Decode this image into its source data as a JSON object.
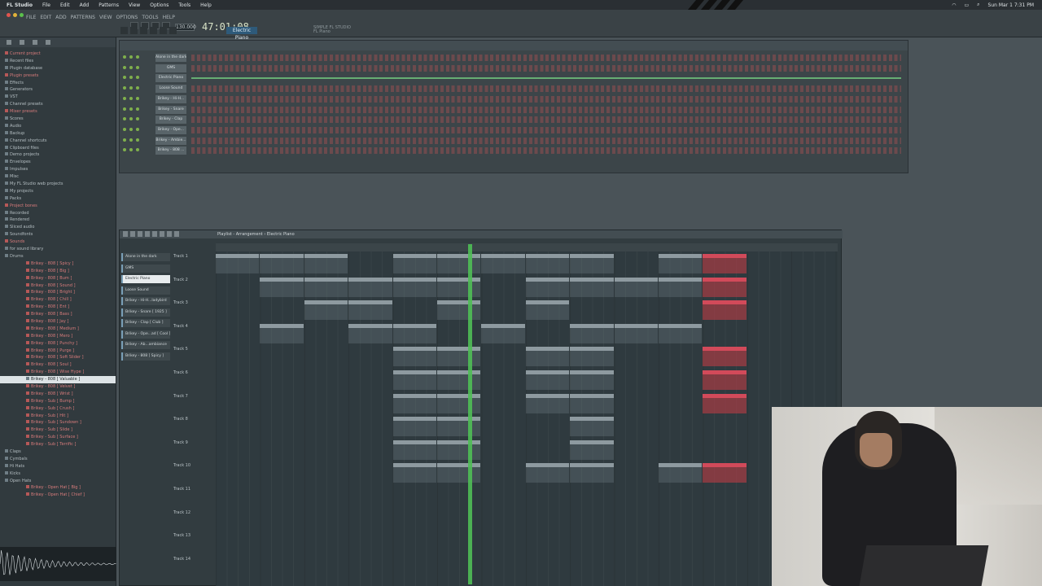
{
  "menubar": {
    "app": "FL Studio",
    "items": [
      "File",
      "Edit",
      "Add",
      "Patterns",
      "View",
      "Options",
      "Tools",
      "Help"
    ],
    "clock": "Sun Mar 1  7:31 PM"
  },
  "fl": {
    "menu": [
      "FILE",
      "EDIT",
      "ADD",
      "PATTERNS",
      "VIEW",
      "OPTIONS",
      "TOOLS",
      "HELP"
    ],
    "tempo": "130.000",
    "time": "47:01:08",
    "pattern": "Electric Piano",
    "hint": "SIMPLE FL STUDIO\nFL Piano"
  },
  "browser": {
    "items": [
      {
        "label": "Current project",
        "style": "red"
      },
      {
        "label": "Recent files",
        "style": "normal"
      },
      {
        "label": "Plugin database",
        "style": "normal"
      },
      {
        "label": "Plugin presets",
        "style": "red"
      },
      {
        "label": "Effects",
        "style": "normal"
      },
      {
        "label": "Generators",
        "style": "normal"
      },
      {
        "label": "VST",
        "style": "normal"
      },
      {
        "label": "Channel presets",
        "style": "normal"
      },
      {
        "label": "Mixer presets",
        "style": "red"
      },
      {
        "label": "Scores",
        "style": "normal"
      },
      {
        "label": "Audio",
        "style": "normal"
      },
      {
        "label": "Backup",
        "style": "normal"
      },
      {
        "label": "Channel shortcuts",
        "style": "normal"
      },
      {
        "label": "Clipboard files",
        "style": "normal"
      },
      {
        "label": "Demo projects",
        "style": "normal"
      },
      {
        "label": "Envelopes",
        "style": "normal"
      },
      {
        "label": "Impulses",
        "style": "normal"
      },
      {
        "label": "Misc",
        "style": "normal"
      },
      {
        "label": "My FL Studio web projects",
        "style": "normal"
      },
      {
        "label": "My projects",
        "style": "normal"
      },
      {
        "label": "Packs",
        "style": "normal"
      },
      {
        "label": "Project bones",
        "style": "red"
      },
      {
        "label": "Recorded",
        "style": "normal"
      },
      {
        "label": "Rendered",
        "style": "normal"
      },
      {
        "label": "Sliced audio",
        "style": "normal"
      },
      {
        "label": "Soundfonts",
        "style": "normal"
      },
      {
        "label": "Sounds",
        "style": "red"
      },
      {
        "label": "for sound library",
        "style": "normal"
      },
      {
        "label": "Drums",
        "style": "normal"
      },
      {
        "label": "Brikey - 808 [ Spicy ]",
        "style": "red"
      },
      {
        "label": "Brikey - 808 [ Big ]",
        "style": "red"
      },
      {
        "label": "Brikey - 808 [ Bum ]",
        "style": "red"
      },
      {
        "label": "Brikey - 808 [ Sound ]",
        "style": "red"
      },
      {
        "label": "Brikey - 808 [ Bright ]",
        "style": "red"
      },
      {
        "label": "Brikey - 808 [ Chill ]",
        "style": "red"
      },
      {
        "label": "Brikey - 808 [ Ent ]",
        "style": "red"
      },
      {
        "label": "Brikey - 808 [ Bass ]",
        "style": "red"
      },
      {
        "label": "Brikey - 808 [ Jay ]",
        "style": "red"
      },
      {
        "label": "Brikey - 808 [ Medium ]",
        "style": "red"
      },
      {
        "label": "Brikey - 808 [ Mero ]",
        "style": "red"
      },
      {
        "label": "Brikey - 808 [ Punchy ]",
        "style": "red"
      },
      {
        "label": "Brikey - 808 [ Purge ]",
        "style": "red"
      },
      {
        "label": "Brikey - 808 [ Soft Slider ]",
        "style": "red"
      },
      {
        "label": "Brikey - 808 [ Soul ]",
        "style": "red"
      },
      {
        "label": "Brikey - 808 [ Wise Hype ]",
        "style": "red"
      },
      {
        "label": "Brikey - 808 [ Valuable ]",
        "style": "sel"
      },
      {
        "label": "Brikey - 808 [ Velvet ]",
        "style": "red"
      },
      {
        "label": "Brikey - 808 [ Wrist ]",
        "style": "red"
      },
      {
        "label": "Brikey - Sub [ Bump ]",
        "style": "red"
      },
      {
        "label": "Brikey - Sub [ Crush ]",
        "style": "red"
      },
      {
        "label": "Brikey - Sub [ Hit ]",
        "style": "red"
      },
      {
        "label": "Brikey - Sub [ Sundown ]",
        "style": "red"
      },
      {
        "label": "Brikey - Sub [ Slide ]",
        "style": "red"
      },
      {
        "label": "Brikey - Sub [ Surface ]",
        "style": "red"
      },
      {
        "label": "Brikey - Sub [ Terrific ]",
        "style": "red"
      },
      {
        "label": "Claps",
        "style": "normal"
      },
      {
        "label": "Cymbals",
        "style": "normal"
      },
      {
        "label": "Hi Hats",
        "style": "normal"
      },
      {
        "label": "Kicks",
        "style": "normal"
      },
      {
        "label": "Open Hats",
        "style": "normal"
      },
      {
        "label": "Brikey - Open Hat [ Big ]",
        "style": "red"
      },
      {
        "label": "Brikey - Open Hat [ Chief ]",
        "style": "red"
      }
    ]
  },
  "rack": {
    "channels": [
      {
        "name": "Alone in the dark",
        "melodic": false
      },
      {
        "name": "GMS",
        "melodic": false
      },
      {
        "name": "Electric Piano",
        "melodic": true
      },
      {
        "name": "Loose Sound",
        "melodic": false
      },
      {
        "name": "Brikey - Hi-H...",
        "melodic": false
      },
      {
        "name": "Brikey - Snare",
        "melodic": false
      },
      {
        "name": "Brikey - Clap",
        "melodic": false
      },
      {
        "name": "Brikey - Ope...",
        "melodic": false
      },
      {
        "name": "Brikey - Ambie...",
        "melodic": false
      },
      {
        "name": "Brikey - 808 ...",
        "melodic": false
      }
    ]
  },
  "playlist": {
    "title": "Playlist - Arrangement › Electric Piano",
    "patterns": [
      {
        "name": "Alone in the dark",
        "sel": false
      },
      {
        "name": "GMS",
        "sel": false
      },
      {
        "name": "Electric Piano",
        "sel": true
      },
      {
        "name": "Loose Sound",
        "sel": false
      },
      {
        "name": "Brikey - Hi-H...ladybird",
        "sel": false
      },
      {
        "name": "Brikey - Snare [ 1925 ]",
        "sel": false
      },
      {
        "name": "Brikey - Clap [ Club ]",
        "sel": false
      },
      {
        "name": "Brikey - Ope...ad [ Cool ]",
        "sel": false
      },
      {
        "name": "Brikey - Ab...ambiance",
        "sel": false
      },
      {
        "name": "Brikey - 808 [ Spicy ]",
        "sel": false
      }
    ],
    "tracks": [
      "Track 1",
      "Track 2",
      "Track 3",
      "Track 4",
      "Track 5",
      "Track 6",
      "Track 7",
      "Track 8",
      "Track 9",
      "Track 10",
      "Track 11",
      "Track 12",
      "Track 13",
      "Track 14"
    ],
    "clips": [
      {
        "track": 1,
        "start": 1,
        "len": 4,
        "label": "Alone in the dark",
        "sel": false
      },
      {
        "track": 1,
        "start": 5,
        "len": 4,
        "label": "Alone in the dark",
        "sel": false
      },
      {
        "track": 1,
        "start": 9,
        "len": 4,
        "label": "Alone in the dark",
        "sel": false
      },
      {
        "track": 1,
        "start": 17,
        "len": 4,
        "label": "Alone in the dark",
        "sel": false
      },
      {
        "track": 1,
        "start": 21,
        "len": 4,
        "label": "Alone in the dark",
        "sel": false
      },
      {
        "track": 1,
        "start": 25,
        "len": 4,
        "label": "Alone in the dark",
        "sel": false
      },
      {
        "track": 1,
        "start": 29,
        "len": 4,
        "label": "Alone in the dark",
        "sel": false
      },
      {
        "track": 1,
        "start": 33,
        "len": 4,
        "label": "Alone in the dark",
        "sel": false
      },
      {
        "track": 1,
        "start": 41,
        "len": 4,
        "label": "Alone in the dark",
        "sel": false
      },
      {
        "track": 1,
        "start": 45,
        "len": 4,
        "label": "Alone in the dark",
        "sel": true
      },
      {
        "track": 2,
        "start": 5,
        "len": 4,
        "label": "GMS",
        "sel": false
      },
      {
        "track": 2,
        "start": 9,
        "len": 4,
        "label": "GMS",
        "sel": false
      },
      {
        "track": 2,
        "start": 13,
        "len": 4,
        "label": "GMS",
        "sel": false
      },
      {
        "track": 2,
        "start": 17,
        "len": 4,
        "label": "GMS",
        "sel": false
      },
      {
        "track": 2,
        "start": 21,
        "len": 4,
        "label": "GMS",
        "sel": false
      },
      {
        "track": 2,
        "start": 29,
        "len": 4,
        "label": "GMS",
        "sel": false
      },
      {
        "track": 2,
        "start": 33,
        "len": 4,
        "label": "GMS",
        "sel": false
      },
      {
        "track": 2,
        "start": 37,
        "len": 4,
        "label": "GMS",
        "sel": false
      },
      {
        "track": 2,
        "start": 41,
        "len": 4,
        "label": "GMS",
        "sel": false
      },
      {
        "track": 2,
        "start": 45,
        "len": 4,
        "label": "GMS",
        "sel": true
      },
      {
        "track": 3,
        "start": 9,
        "len": 4,
        "label": "Electric Piano",
        "sel": false
      },
      {
        "track": 3,
        "start": 13,
        "len": 4,
        "label": "Electric Piano",
        "sel": false
      },
      {
        "track": 3,
        "start": 21,
        "len": 4,
        "label": "Electric Piano",
        "sel": false
      },
      {
        "track": 3,
        "start": 29,
        "len": 4,
        "label": "Electric Piano",
        "sel": false
      },
      {
        "track": 3,
        "start": 45,
        "len": 4,
        "label": "Electric Piano",
        "sel": true
      },
      {
        "track": 4,
        "start": 5,
        "len": 4,
        "label": "Loose Sound",
        "sel": false
      },
      {
        "track": 4,
        "start": 13,
        "len": 4,
        "label": "Loose Sound",
        "sel": false
      },
      {
        "track": 4,
        "start": 17,
        "len": 4,
        "label": "Loose Sound",
        "sel": false
      },
      {
        "track": 4,
        "start": 25,
        "len": 4,
        "label": "Loose Sound",
        "sel": false
      },
      {
        "track": 4,
        "start": 33,
        "len": 4,
        "label": "Loose Sound",
        "sel": false
      },
      {
        "track": 4,
        "start": 37,
        "len": 4,
        "label": "Loose Sound",
        "sel": false
      },
      {
        "track": 4,
        "start": 41,
        "len": 4,
        "label": "Loose Sound",
        "sel": false
      },
      {
        "track": 5,
        "start": 17,
        "len": 4,
        "label": "Brikey - Hi-H...ladybird",
        "sel": false
      },
      {
        "track": 5,
        "start": 21,
        "len": 4,
        "label": "Brikey - Hi-H...ladybird",
        "sel": false
      },
      {
        "track": 5,
        "start": 29,
        "len": 4,
        "label": "Brikey - Hi-H...ladybird",
        "sel": false
      },
      {
        "track": 5,
        "start": 33,
        "len": 4,
        "label": "Brikey - Hi-H...ladybird",
        "sel": false
      },
      {
        "track": 5,
        "start": 45,
        "len": 4,
        "label": "Brikey - Hi-H...ladybird",
        "sel": true
      },
      {
        "track": 6,
        "start": 17,
        "len": 4,
        "label": "Brikey - Snare [ 1925 ]",
        "sel": false
      },
      {
        "track": 6,
        "start": 21,
        "len": 4,
        "label": "Brikey - Snare [ 1925 ]",
        "sel": false
      },
      {
        "track": 6,
        "start": 29,
        "len": 4,
        "label": "Brikey - Snare [ 1925 ]",
        "sel": false
      },
      {
        "track": 6,
        "start": 33,
        "len": 4,
        "label": "Brikey - Snare [ 1925 ]",
        "sel": false
      },
      {
        "track": 6,
        "start": 45,
        "len": 4,
        "label": "Brikey - Snare [ 1925 ]",
        "sel": true
      },
      {
        "track": 7,
        "start": 17,
        "len": 4,
        "label": "Brikey - Clap [ Club ]",
        "sel": false
      },
      {
        "track": 7,
        "start": 21,
        "len": 4,
        "label": "Brikey - Clap [ Club ]",
        "sel": false
      },
      {
        "track": 7,
        "start": 29,
        "len": 4,
        "label": "Brikey - Clap [ Club ]",
        "sel": false
      },
      {
        "track": 7,
        "start": 33,
        "len": 4,
        "label": "Brikey - Clap [ Club ]",
        "sel": false
      },
      {
        "track": 7,
        "start": 45,
        "len": 4,
        "label": "Brikey - Clap [ Club ]",
        "sel": true
      },
      {
        "track": 8,
        "start": 17,
        "len": 4,
        "label": "Brikey - Op...ad [ Cool ]",
        "sel": false
      },
      {
        "track": 8,
        "start": 21,
        "len": 4,
        "label": "Brikey - Op...ad [ Cool ]",
        "sel": false
      },
      {
        "track": 8,
        "start": 33,
        "len": 4,
        "label": "Brikey - Op...ad [ Cool ]",
        "sel": false
      },
      {
        "track": 9,
        "start": 17,
        "len": 4,
        "label": "Brikey - Ab...ambiance",
        "sel": false
      },
      {
        "track": 9,
        "start": 21,
        "len": 4,
        "label": "Brikey - Ab...ambiance",
        "sel": false
      },
      {
        "track": 9,
        "start": 33,
        "len": 4,
        "label": "Brikey - Ab...ambiance",
        "sel": false
      },
      {
        "track": 10,
        "start": 17,
        "len": 4,
        "label": "Brikey - 808 [ Spicy ]",
        "sel": false
      },
      {
        "track": 10,
        "start": 21,
        "len": 4,
        "label": "Brikey - 808 [ Spicy ]",
        "sel": false
      },
      {
        "track": 10,
        "start": 29,
        "len": 4,
        "label": "Brikey - 808 [ Spicy ]",
        "sel": false
      },
      {
        "track": 10,
        "start": 33,
        "len": 4,
        "label": "Brikey - 808 [ Spicy ]",
        "sel": false
      },
      {
        "track": 10,
        "start": 41,
        "len": 4,
        "label": "Brikey - 808 [ Spicy ]",
        "sel": false
      },
      {
        "track": 10,
        "start": 45,
        "len": 4,
        "label": "Brikey - 808 [ Spicy ]",
        "sel": true
      }
    ]
  }
}
